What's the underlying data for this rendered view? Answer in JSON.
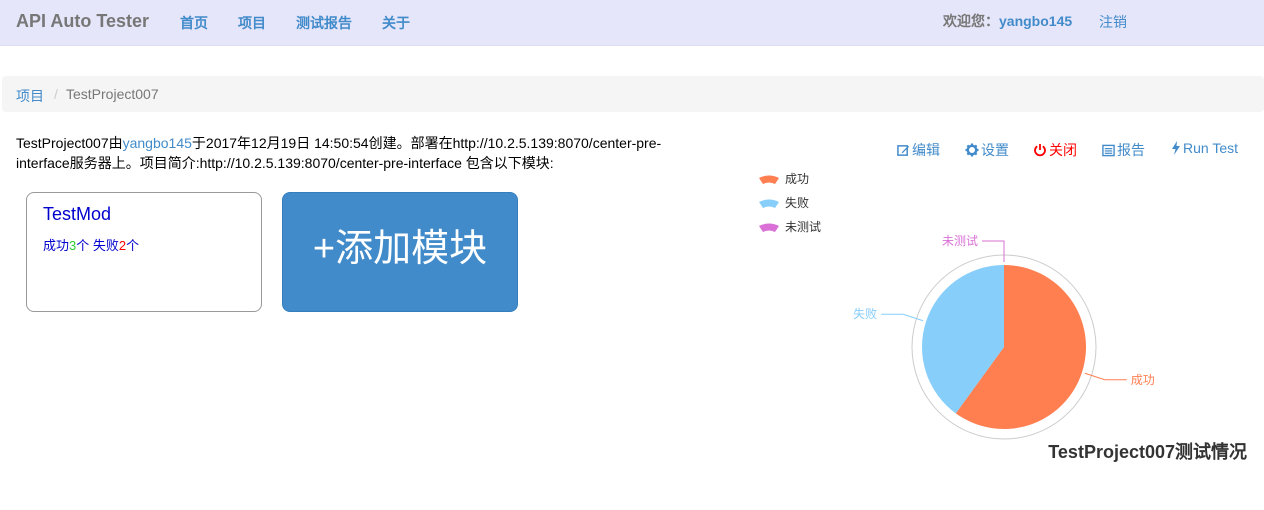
{
  "navbar": {
    "brand": "API Auto Tester",
    "links": [
      "首页",
      "项目",
      "测试报告",
      "关于"
    ],
    "welcome_prefix": "欢迎您：",
    "username": "yangbo145",
    "logout": "注销"
  },
  "breadcrumb": {
    "parent": "项目",
    "separator": "/",
    "current": "TestProject007"
  },
  "description": {
    "project": "TestProject007",
    "by": "由",
    "creator": "yangbo145",
    "created_text": "于2017年12月19日 14:50:54创建。部署在http://10.2.5.139:8070/center-pre-interface服务器上。项目简介:http://10.2.5.139:8070/center-pre-interface 包含以下模块:"
  },
  "modules": [
    {
      "name": "TestMod",
      "success_label": "成功",
      "success_count": "3",
      "unit1": "个 ",
      "fail_label": "失败",
      "fail_count": "2",
      "unit2": "个"
    }
  ],
  "add_module_label": "+添加模块",
  "actions": {
    "edit": "编辑",
    "settings": "设置",
    "close": "关闭",
    "report": "报告",
    "run_test": "Run Test"
  },
  "colors": {
    "success": "#ff7f50",
    "fail": "#87cefa",
    "untested": "#da70d6",
    "link": "#428bca"
  },
  "chart_data": {
    "type": "pie",
    "title": "TestProject007测试情况",
    "legend_position": "top-left",
    "slices": [
      {
        "name": "成功",
        "value": 3
      },
      {
        "name": "失败",
        "value": 2
      },
      {
        "name": "未测试",
        "value": 0
      }
    ]
  }
}
